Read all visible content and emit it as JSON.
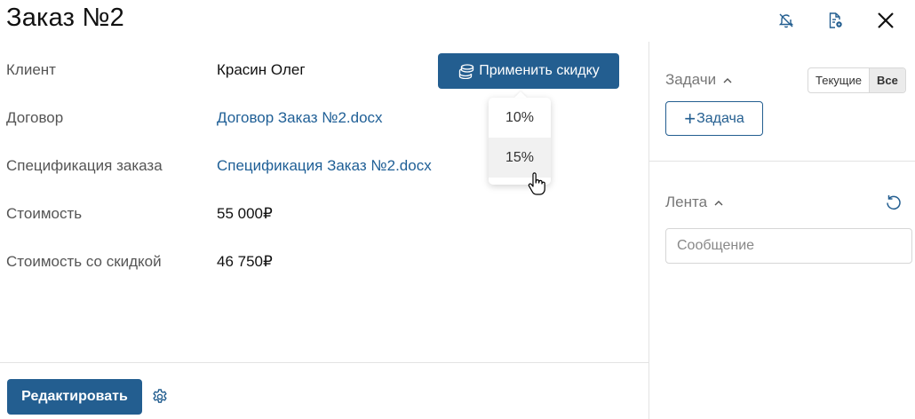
{
  "header": {
    "title": "Заказ №2",
    "icons": [
      "bell-off-icon",
      "document-settings-icon",
      "close-icon"
    ]
  },
  "fields": [
    {
      "label": "Клиент",
      "value": "Красин Олег",
      "link": false
    },
    {
      "label": "Договор",
      "value": "Договор Заказ №2.docx",
      "link": true
    },
    {
      "label": "Спецификация заказа",
      "value": "Спецификация Заказ №2.docx",
      "link": true
    },
    {
      "label": "Стоимость",
      "value": "55 000₽",
      "link": false
    },
    {
      "label": "Стоимость со скидкой",
      "value": "46 750₽",
      "link": false
    }
  ],
  "discount": {
    "button_label": "Применить скидку",
    "options": [
      "10%",
      "15%"
    ],
    "hovered_option": "15%"
  },
  "footer": {
    "edit_label": "Редактировать"
  },
  "sidebar": {
    "tasks": {
      "heading": "Задачи",
      "filters": [
        "Текущие",
        "Все"
      ],
      "active_filter": "Все",
      "add_label": "Задача"
    },
    "feed": {
      "heading": "Лента",
      "message_placeholder": "Сообщение"
    }
  },
  "colors": {
    "primary": "#235e90",
    "link": "#1f5f96"
  }
}
